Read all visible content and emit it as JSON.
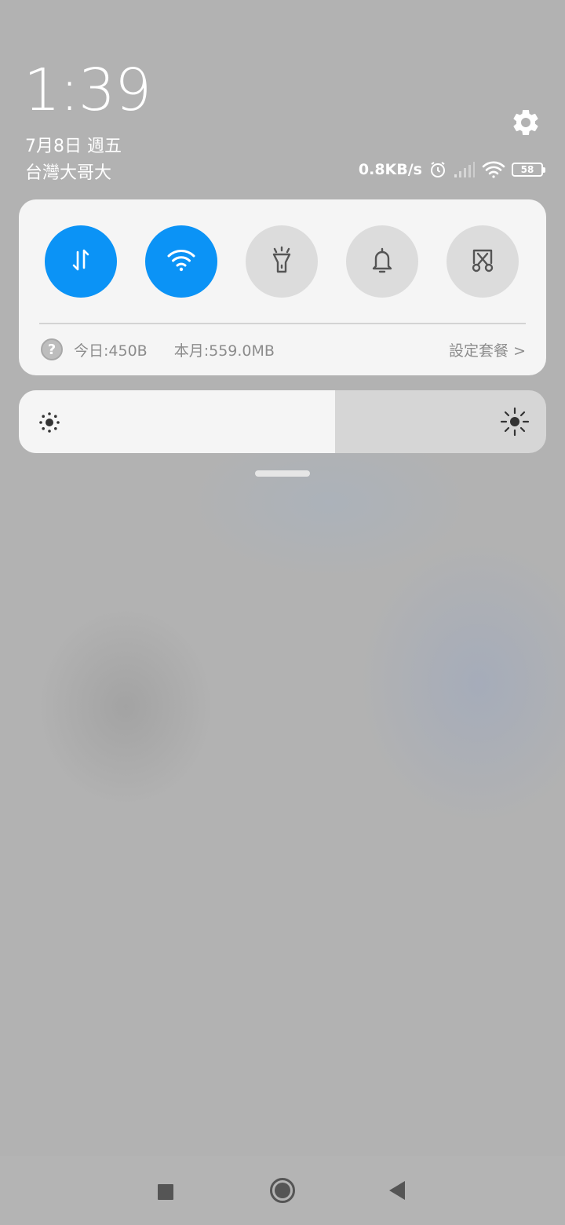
{
  "status": {
    "time": "1:39",
    "date": "7月8日 週五",
    "carrier": "台灣大哥大",
    "network_speed": "0.8KB/s",
    "battery_level": "58",
    "icons": [
      "alarm-icon",
      "cell-signal-icon",
      "wifi-signal-icon",
      "battery-icon"
    ]
  },
  "quick_settings": {
    "toggles": [
      {
        "name": "mobile-data",
        "icon": "data-arrows-icon",
        "active": true
      },
      {
        "name": "wifi",
        "icon": "wifi-icon",
        "active": true
      },
      {
        "name": "flashlight",
        "icon": "flashlight-icon",
        "active": false
      },
      {
        "name": "notifications",
        "icon": "bell-icon",
        "active": false
      },
      {
        "name": "screenshot",
        "icon": "screenshot-scissors-icon",
        "active": false
      }
    ],
    "data_usage": {
      "help_glyph": "?",
      "today": "今日:450B",
      "month": "本月:559.0MB",
      "plan_link": "設定套餐 >"
    }
  },
  "brightness": {
    "level": 0.6,
    "low_icon": "brightness-low-icon",
    "high_icon": "brightness-high-icon"
  },
  "colors": {
    "accent": "#0b93f6",
    "panel": "#f5f5f5",
    "inactive_toggle": "#dcdcdc",
    "background": "#b2b2b2"
  },
  "navigation": {
    "buttons": [
      "recent-apps",
      "home",
      "back"
    ]
  }
}
